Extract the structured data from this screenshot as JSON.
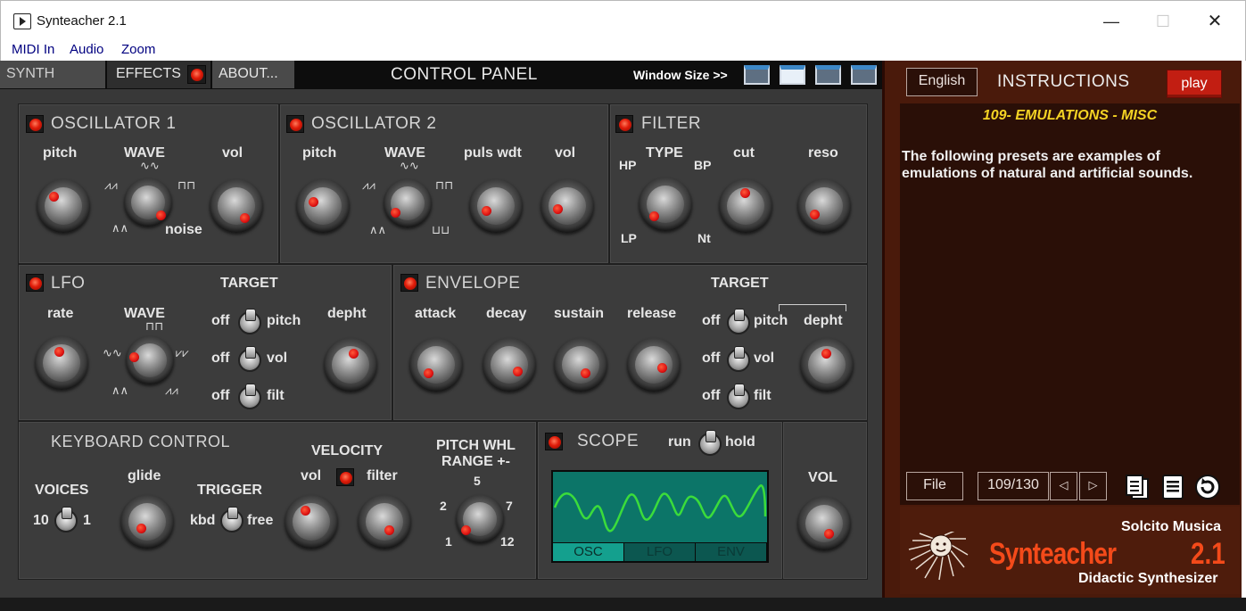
{
  "window": {
    "title": "Synteacher 2.1",
    "min_glyph": "—",
    "max_glyph": "☐",
    "close_glyph": "✕"
  },
  "menu": [
    "MIDI In",
    "Audio",
    "Zoom"
  ],
  "tabs": {
    "synth": "SYNTH",
    "effects": "EFFECTS",
    "about": "ABOUT..."
  },
  "control_panel_title": "CONTROL PANEL",
  "window_size_label": "Window Size >>",
  "osc1": {
    "title": "OSCILLATOR 1",
    "pitch": "pitch",
    "wave": "WAVE",
    "vol": "vol",
    "noise": "noise"
  },
  "osc2": {
    "title": "OSCILLATOR 2",
    "pitch": "pitch",
    "wave": "WAVE",
    "puls": "puls wdt",
    "vol": "vol"
  },
  "filter": {
    "title": "FILTER",
    "type": "TYPE",
    "hp": "HP",
    "bp": "BP",
    "lp": "LP",
    "nt": "Nt",
    "cut": "cut",
    "reso": "reso"
  },
  "lfo": {
    "title": "LFO",
    "rate": "rate",
    "wave": "WAVE",
    "target": "TARGET",
    "depth": "depht",
    "off": "off",
    "t_pitch": "pitch",
    "t_vol": "vol",
    "t_filt": "filt"
  },
  "envelope": {
    "title": "ENVELOPE",
    "attack": "attack",
    "decay": "decay",
    "sustain": "sustain",
    "release": "release",
    "target": "TARGET",
    "depth": "depht",
    "off": "off",
    "t_pitch": "pitch",
    "t_vol": "vol",
    "t_filt": "filt"
  },
  "keyboard": {
    "title": "KEYBOARD CONTROL",
    "voices": "VOICES",
    "voices_lo": "10",
    "voices_hi": "1",
    "glide": "glide",
    "trigger": "TRIGGER",
    "kbd": "kbd",
    "free": "free",
    "velocity": "VELOCITY",
    "vel_vol": "vol",
    "vel_filter": "filter",
    "pitch_whl": "PITCH WHL",
    "range": "RANGE +-",
    "r5": "5",
    "r2": "2",
    "r7": "7",
    "r1": "1",
    "r12": "12"
  },
  "scope": {
    "title": "SCOPE",
    "run": "run",
    "hold": "hold",
    "tabs": [
      "OSC",
      "LFO",
      "ENV"
    ]
  },
  "vol_label": "VOL",
  "instructions": {
    "language": "English",
    "title": "INSTRUCTIONS",
    "play": "play",
    "preset_name": "109- EMULATIONS - MISC",
    "text": "The following presets are examples of emulations of natural and artificial sounds.",
    "file": "File",
    "counter": "109/130",
    "prev_glyph": "◁",
    "next_glyph": "▷"
  },
  "brand": {
    "company": "Solcito Musica",
    "product": "Synteacher",
    "version": "2.1",
    "tagline": "Didactic Synthesizer"
  },
  "colors": {
    "panel": "#3c3c3c",
    "led": "#e01c0a",
    "instr_bg": "#4a1a0b",
    "preset_yellow": "#f4d324",
    "scope": "#0c7568"
  }
}
